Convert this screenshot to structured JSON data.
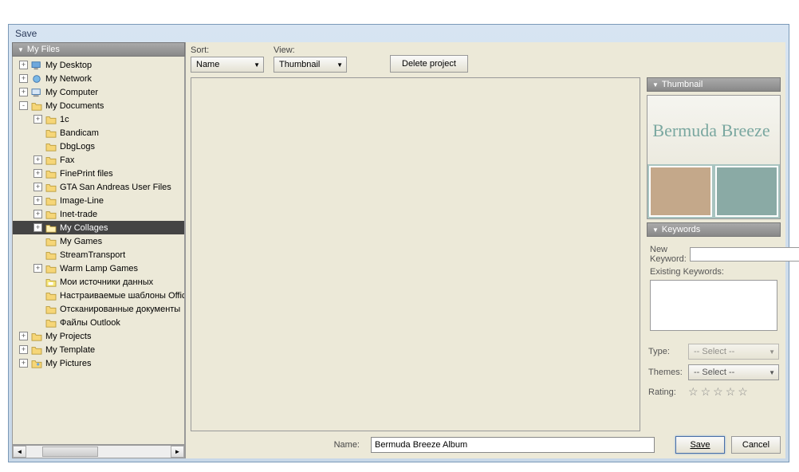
{
  "title": "Save",
  "sidebar_header": "My Files",
  "tree": [
    {
      "indent": 0,
      "exp": "+",
      "icon": "desktop",
      "label": "My Desktop"
    },
    {
      "indent": 0,
      "exp": "+",
      "icon": "network",
      "label": "My Network"
    },
    {
      "indent": 0,
      "exp": "+",
      "icon": "computer",
      "label": "My Computer"
    },
    {
      "indent": 0,
      "exp": "-",
      "icon": "folder",
      "label": "My Documents"
    },
    {
      "indent": 1,
      "exp": "+",
      "icon": "folder",
      "label": "1c"
    },
    {
      "indent": 1,
      "exp": "",
      "icon": "folder",
      "label": "Bandicam"
    },
    {
      "indent": 1,
      "exp": "",
      "icon": "folder",
      "label": "DbgLogs"
    },
    {
      "indent": 1,
      "exp": "+",
      "icon": "folder",
      "label": "Fax"
    },
    {
      "indent": 1,
      "exp": "+",
      "icon": "folder",
      "label": "FinePrint files"
    },
    {
      "indent": 1,
      "exp": "+",
      "icon": "folder",
      "label": "GTA San Andreas User Files"
    },
    {
      "indent": 1,
      "exp": "+",
      "icon": "folder",
      "label": "Image-Line"
    },
    {
      "indent": 1,
      "exp": "+",
      "icon": "folder",
      "label": "Inet-trade"
    },
    {
      "indent": 1,
      "exp": "+",
      "icon": "folder-open",
      "label": "My Collages",
      "selected": true
    },
    {
      "indent": 1,
      "exp": "",
      "icon": "folder",
      "label": "My Games"
    },
    {
      "indent": 1,
      "exp": "",
      "icon": "folder",
      "label": "StreamTransport"
    },
    {
      "indent": 1,
      "exp": "+",
      "icon": "folder",
      "label": "Warm Lamp Games"
    },
    {
      "indent": 1,
      "exp": "",
      "icon": "folder-sp",
      "label": "Мои источники данных"
    },
    {
      "indent": 1,
      "exp": "",
      "icon": "folder",
      "label": "Настраиваемые шаблоны Office"
    },
    {
      "indent": 1,
      "exp": "",
      "icon": "folder",
      "label": "Отсканированные документы"
    },
    {
      "indent": 1,
      "exp": "",
      "icon": "folder",
      "label": "Файлы Outlook"
    },
    {
      "indent": 0,
      "exp": "+",
      "icon": "folder",
      "label": "My Projects"
    },
    {
      "indent": 0,
      "exp": "+",
      "icon": "folder",
      "label": "My Template"
    },
    {
      "indent": 0,
      "exp": "+",
      "icon": "folder-pic",
      "label": "My Pictures"
    }
  ],
  "toolbar": {
    "sort_label": "Sort:",
    "sort_value": "Name",
    "view_label": "View:",
    "view_value": "Thumbnail",
    "delete_label": "Delete project"
  },
  "right": {
    "thumbnail_header": "Thumbnail",
    "thumb_text": "Bermuda Breeze",
    "keywords_header": "Keywords",
    "new_keyword_label": "New Keyword:",
    "existing_label": "Existing Keywords:",
    "type_label": "Type:",
    "type_value": "-- Select --",
    "themes_label": "Themes:",
    "themes_value": "-- Select --",
    "rating_label": "Rating:"
  },
  "bottom": {
    "name_label": "Name:",
    "name_value": "Bermuda Breeze Album",
    "save_label": "Save",
    "cancel_label": "Cancel"
  }
}
